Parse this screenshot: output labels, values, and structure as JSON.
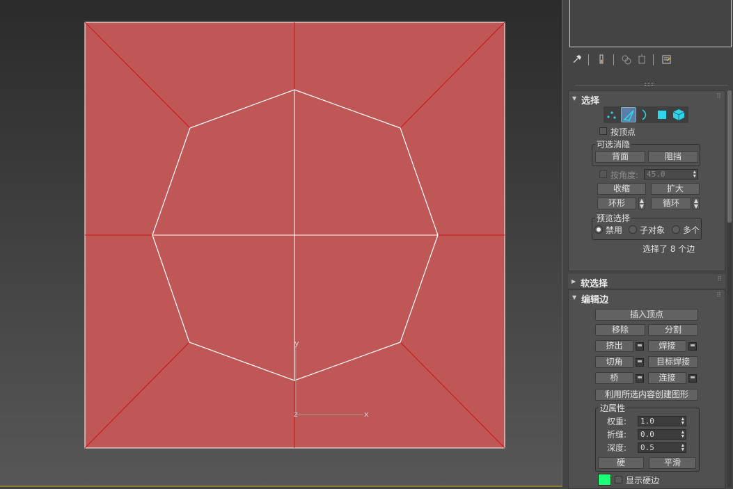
{
  "viewport": {
    "plane_color": "#c05757",
    "edge_selected_color": "#ffffff",
    "edge_color": "#cc1111",
    "axis_labels": {
      "y": "y",
      "z": "z",
      "x": "x"
    }
  },
  "toolbar": {
    "icons": [
      "pin-icon",
      "modifier-stack-icon",
      "make-unique-icon",
      "remove-modifier-icon",
      "configure-modifier-sets-icon"
    ]
  },
  "selection": {
    "title": "选择",
    "by_vertex": "按顶点",
    "cull_group": "可选消隐",
    "back_face": "背面",
    "occluded": "阻挡",
    "by_angle": "按角度:",
    "angle_value": "45.0",
    "shrink": "收缩",
    "grow": "扩大",
    "ring": "环形",
    "loop": "循环",
    "preview_group": "预览选择",
    "preview_off": "禁用",
    "preview_subobj": "子对象",
    "preview_multi": "多个",
    "status": "选择了 8 个边"
  },
  "soft_selection": {
    "title": "软选择"
  },
  "edit_edges": {
    "title": "编辑边",
    "insert_vertex": "插入顶点",
    "remove": "移除",
    "split": "分割",
    "extrude": "挤出",
    "weld": "焊接",
    "chamfer": "切角",
    "target_weld": "目标焊接",
    "bridge": "桥",
    "connect": "连接",
    "create_shape": "利用所选内容创建图形",
    "edge_props": "边属性",
    "weight_label": "权重:",
    "weight_value": "1.0",
    "crease_label": "折缝:",
    "crease_value": "0.0",
    "depth_label": "深度:",
    "depth_value": "0.5",
    "hard": "硬",
    "smooth": "平滑",
    "show_hard": "显示硬边",
    "hard_edge_color": "#1eff78"
  }
}
